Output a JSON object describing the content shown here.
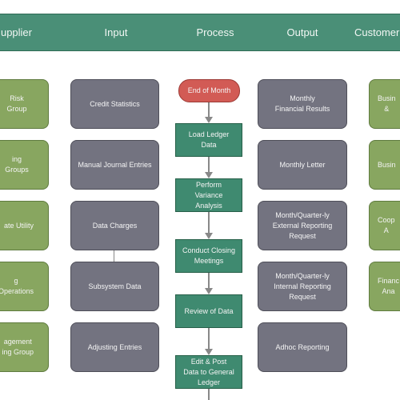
{
  "headers": [
    "upplier",
    "Input",
    "Process",
    "Output",
    "Customer"
  ],
  "supplier": [
    "Risk Group",
    "ing Groups",
    "ate Utility",
    "g Operations",
    "agement\ning Group"
  ],
  "input": [
    "Credit Statistics",
    "Manual Journal Entries",
    "Data Charges",
    "Subsystem Data",
    "Adjusting Entries"
  ],
  "process_start": "End of Month",
  "process": [
    "Load Ledger\nData",
    "Perform\nVariance\nAnalysis",
    "Conduct Closing\nMeetings",
    "Review of Data",
    "Edit & Post\nData to General\nLedger"
  ],
  "output": [
    "Monthly\nFinancial Results",
    "Monthly Letter",
    "Month/Quarter-ly\nExternal Reporting\nRequest",
    "Month/Quarter-ly\nInternal Reporting\nRequest",
    "Adhoc Reporting"
  ],
  "customer": [
    "Busin\n&",
    "Busin",
    "Coop\nA",
    "Financ\nAna"
  ],
  "colors": {
    "header": "#4a8f77",
    "supplier": "#88a660",
    "input": "#737380",
    "process": "#3f8a70",
    "start": "#d25b55",
    "output": "#737380",
    "customer": "#88a660"
  }
}
